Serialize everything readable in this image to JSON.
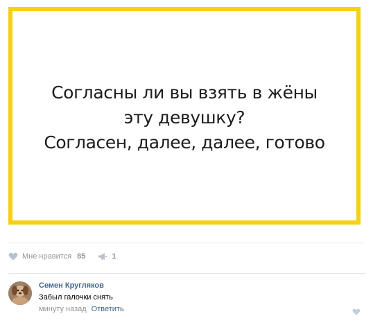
{
  "post": {
    "image_text_lines": [
      "Согласны ли вы взять в жёны",
      "эту девушку?",
      "Согласен, далее, далее, готово"
    ],
    "image_border_color": "#f5d016"
  },
  "actions": {
    "like_label": "Мне нравится",
    "like_count": "85",
    "repost_count": "1",
    "like_icon": "heart-icon",
    "repost_icon": "megaphone-icon"
  },
  "comment": {
    "author": "Семен Кругляков",
    "text": "Забыл галочки снять",
    "time": "минуту назад",
    "reply_label": "Ответить",
    "avatar_icon": "user-avatar",
    "like_icon": "heart-icon"
  },
  "colors": {
    "link": "#42648b",
    "muted": "#939393",
    "divider": "#e7e8ec"
  }
}
